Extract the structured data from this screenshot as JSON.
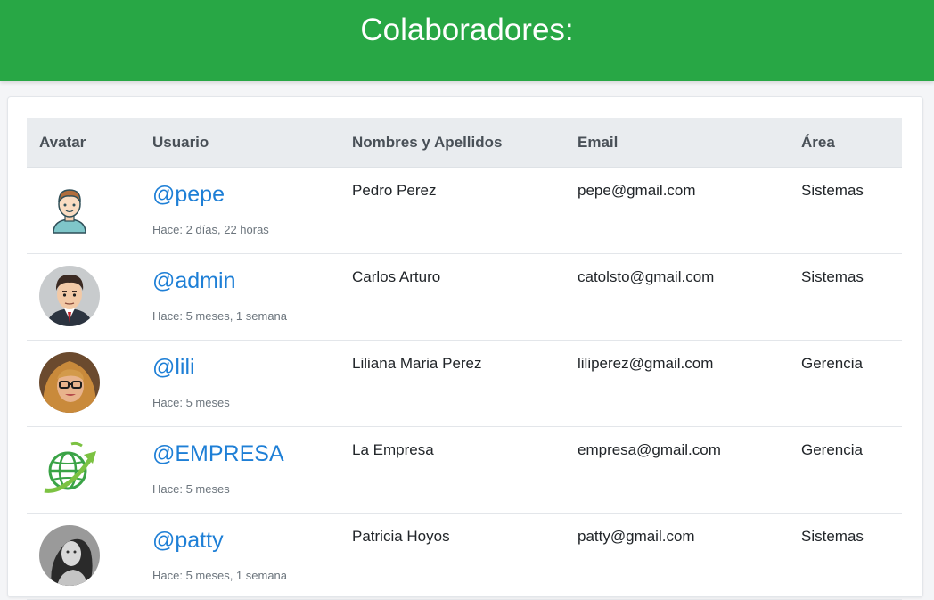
{
  "header": {
    "title": "Colaboradores:"
  },
  "table": {
    "columns": [
      "Avatar",
      "Usuario",
      "Nombres y Apellidos",
      "Email",
      "Área"
    ],
    "rows": [
      {
        "username": "@pepe",
        "since": "Hace: 2 días, 22 horas",
        "name": "Pedro Perez",
        "email": "pepe@gmail.com",
        "area": "Sistemas",
        "avatar": "cartoon-boy-avatar"
      },
      {
        "username": "@admin",
        "since": "Hace: 5 meses, 1 semana",
        "name": "Carlos Arturo",
        "email": "catolsto@gmail.com",
        "area": "Sistemas",
        "avatar": "cartoon-businessman-avatar"
      },
      {
        "username": "@lili",
        "since": "Hace: 5 meses",
        "name": "Liliana Maria Perez",
        "email": "liliperez@gmail.com",
        "area": "Gerencia",
        "avatar": "woman-glasses-photo"
      },
      {
        "username": "@EMPRESA",
        "since": "Hace: 5 meses",
        "name": "La Empresa",
        "email": "empresa@gmail.com",
        "area": "Gerencia",
        "avatar": "green-globe-logo"
      },
      {
        "username": "@patty",
        "since": "Hace: 5 meses, 1 semana",
        "name": "Patricia Hoyos",
        "email": "patty@gmail.com",
        "area": "Sistemas",
        "avatar": "woman-bw-photo"
      }
    ]
  },
  "colors": {
    "header_bg": "#28a745",
    "link": "#1e7fd6",
    "table_head_bg": "#e9ecef"
  }
}
